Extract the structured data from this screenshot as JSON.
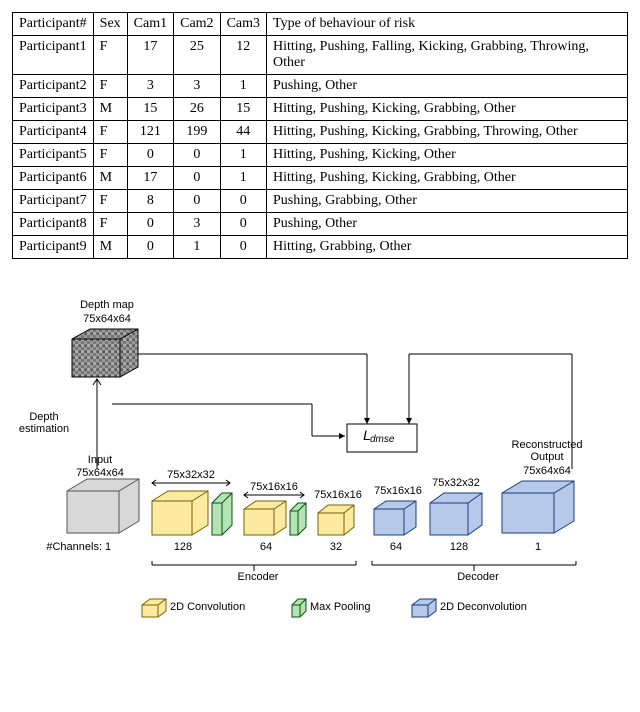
{
  "table": {
    "headers": [
      "Participant#",
      "Sex",
      "Cam1",
      "Cam2",
      "Cam3",
      "Type of behaviour of risk"
    ],
    "rows": [
      {
        "p": "Participant1",
        "sex": "F",
        "c1": "17",
        "c2": "25",
        "c3": "12",
        "t": "Hitting, Pushing, Falling, Kicking, Grabbing, Throwing, Other"
      },
      {
        "p": "Participant2",
        "sex": "F",
        "c1": "3",
        "c2": "3",
        "c3": "1",
        "t": "Pushing, Other"
      },
      {
        "p": "Participant3",
        "sex": "M",
        "c1": "15",
        "c2": "26",
        "c3": "15",
        "t": "Hitting, Pushing, Kicking, Grabbing, Other"
      },
      {
        "p": "Participant4",
        "sex": "F",
        "c1": "121",
        "c2": "199",
        "c3": "44",
        "t": "Hitting, Pushing, Kicking, Grabbing, Throwing, Other"
      },
      {
        "p": "Participant5",
        "sex": "F",
        "c1": "0",
        "c2": "0",
        "c3": "1",
        "t": "Hitting, Pushing, Kicking, Other"
      },
      {
        "p": "Participant6",
        "sex": "M",
        "c1": "17",
        "c2": "0",
        "c3": "1",
        "t": "Hitting, Pushing, Kicking, Grabbing, Other"
      },
      {
        "p": "Participant7",
        "sex": "F",
        "c1": "8",
        "c2": "0",
        "c3": "0",
        "t": "Pushing, Grabbing, Other"
      },
      {
        "p": "Participant8",
        "sex": "F",
        "c1": "0",
        "c2": "3",
        "c3": "0",
        "t": "Pushing, Other"
      },
      {
        "p": "Participant9",
        "sex": "M",
        "c1": "0",
        "c2": "1",
        "c3": "0",
        "t": "Hitting, Grabbing, Other"
      }
    ]
  },
  "diagram": {
    "depth_map": "Depth map",
    "depth_dim": "75x64x64",
    "depth_est": "Depth estimation",
    "input": "Input",
    "input_dim": "75x64x64",
    "dim_32": "75x32x32",
    "dim_16": "75x16x16",
    "dim_16b": "75x16x16",
    "dim_16c": "75x16x16",
    "dim_32b": "75x32x32",
    "recon": "Reconstructed Output",
    "recon_dim": "75x64x64",
    "channels": "#Channels:",
    "ch1": "1",
    "ch128": "128",
    "ch64": "64",
    "ch32": "32",
    "ch64b": "64",
    "ch128b": "128",
    "ch1b": "1",
    "encoder": "Encoder",
    "decoder": "Decoder",
    "loss": "L",
    "loss_sub": "dmse",
    "legend_conv": "2D Convolution",
    "legend_pool": "Max Pooling",
    "legend_deconv": "2D Deconvolution"
  },
  "chart_data": {
    "type": "table",
    "title": "Participant behaviour-of-risk data with camera counts",
    "columns": [
      "Participant#",
      "Sex",
      "Cam1",
      "Cam2",
      "Cam3",
      "Type of behaviour of risk"
    ],
    "rows": [
      [
        "Participant1",
        "F",
        17,
        25,
        12,
        "Hitting, Pushing, Falling, Kicking, Grabbing, Throwing, Other"
      ],
      [
        "Participant2",
        "F",
        3,
        3,
        1,
        "Pushing, Other"
      ],
      [
        "Participant3",
        "M",
        15,
        26,
        15,
        "Hitting, Pushing, Kicking, Grabbing, Other"
      ],
      [
        "Participant4",
        "F",
        121,
        199,
        44,
        "Hitting, Pushing, Kicking, Grabbing, Throwing, Other"
      ],
      [
        "Participant5",
        "F",
        0,
        0,
        1,
        "Hitting, Pushing, Kicking, Other"
      ],
      [
        "Participant6",
        "M",
        17,
        0,
        1,
        "Hitting, Pushing, Kicking, Grabbing, Other"
      ],
      [
        "Participant7",
        "F",
        8,
        0,
        0,
        "Pushing, Grabbing, Other"
      ],
      [
        "Participant8",
        "F",
        0,
        3,
        0,
        "Pushing, Other"
      ],
      [
        "Participant9",
        "M",
        0,
        1,
        0,
        "Hitting, Grabbing, Other"
      ]
    ]
  }
}
